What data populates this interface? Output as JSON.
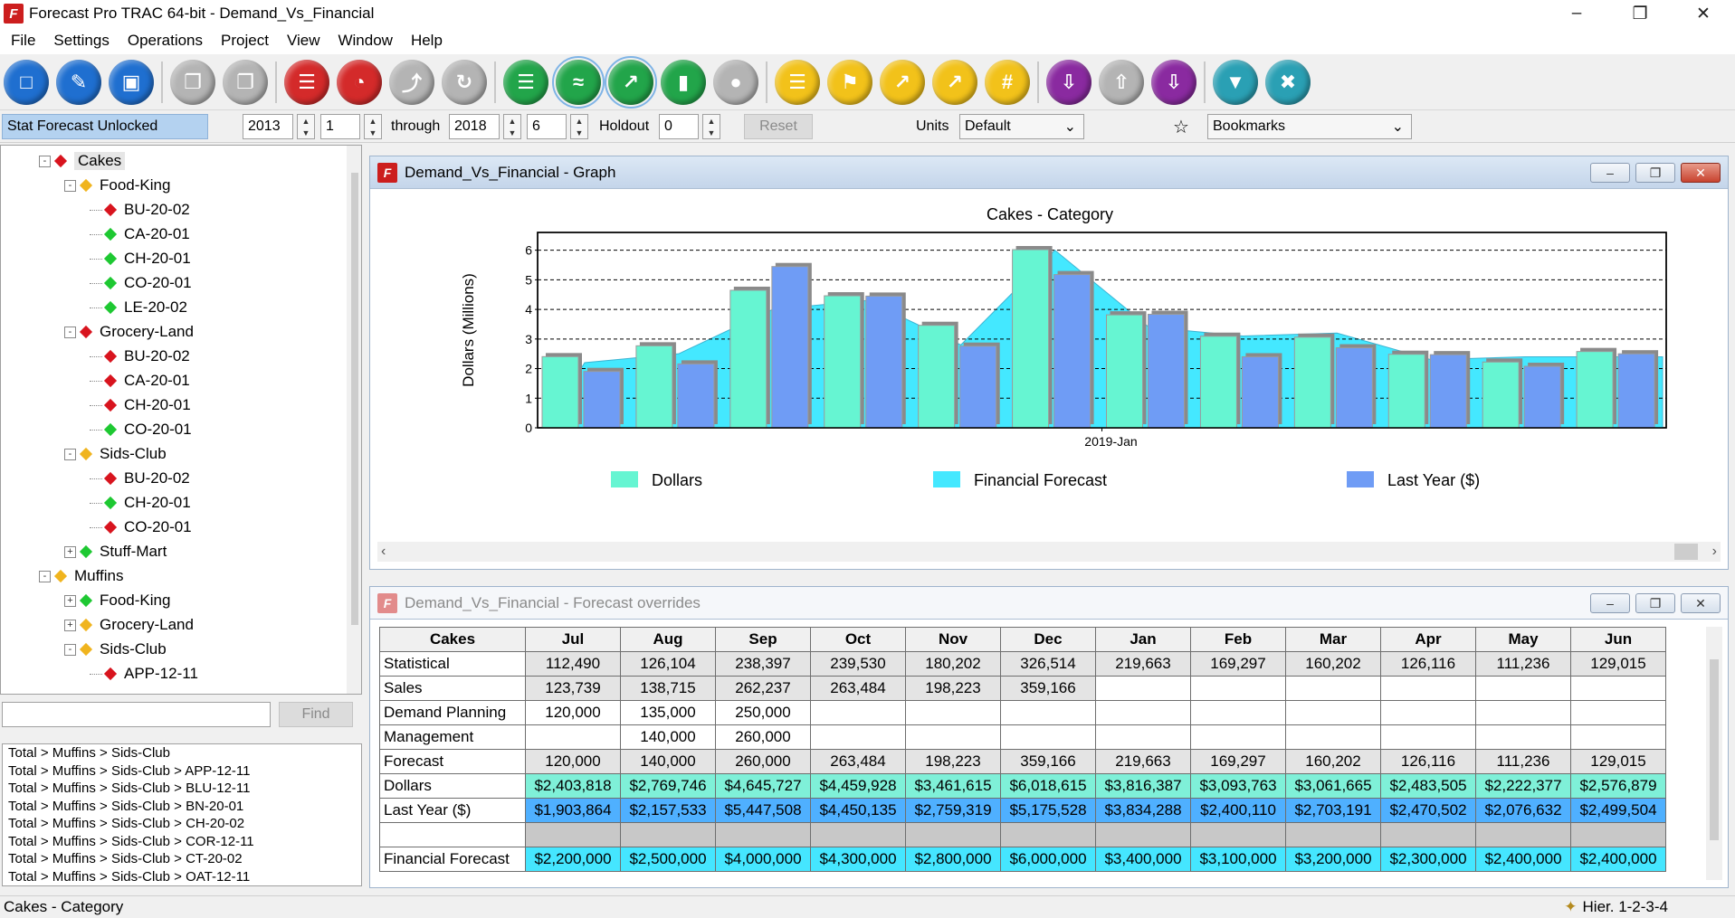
{
  "app": {
    "title": "Forecast Pro TRAC 64-bit - Demand_Vs_Financial",
    "icon": "forecast-pro-logo"
  },
  "menu": [
    "File",
    "Settings",
    "Operations",
    "Project",
    "View",
    "Window",
    "Help"
  ],
  "toolbar_icons": [
    {
      "name": "new-project-icon",
      "color": "#1f6fd0"
    },
    {
      "name": "open-project-icon",
      "color": "#1f6fd0"
    },
    {
      "name": "save-project-icon",
      "color": "#1f6fd0"
    },
    {
      "name": "copy-icon",
      "color": "#b4b4b4"
    },
    {
      "name": "paste-icon",
      "color": "#b4b4b4"
    },
    {
      "name": "database-icon",
      "color": "#d42a2a"
    },
    {
      "name": "pie-chart-icon",
      "color": "#d42a2a"
    },
    {
      "name": "model-icon",
      "color": "#b4b4b4"
    },
    {
      "name": "refresh-icon",
      "color": "#b4b4b4"
    },
    {
      "name": "report-icon",
      "color": "#22a54a"
    },
    {
      "name": "forecast-graph-icon",
      "color": "#22a54a"
    },
    {
      "name": "trend-graph-icon",
      "color": "#22a54a"
    },
    {
      "name": "bar-graph-icon",
      "color": "#22a54a"
    },
    {
      "name": "paw-icon",
      "color": "#b4b4b4"
    },
    {
      "name": "document-icon",
      "color": "#f2c21a"
    },
    {
      "name": "flag-icon",
      "color": "#f2c21a"
    },
    {
      "name": "line-chart-icon",
      "color": "#f2c21a"
    },
    {
      "name": "override-chart-icon",
      "color": "#f2c21a"
    },
    {
      "name": "hash-icon",
      "color": "#f2c21a"
    },
    {
      "name": "export-icon",
      "color": "#8a2aa0"
    },
    {
      "name": "import-icon",
      "color": "#b4b4b4"
    },
    {
      "name": "output-icon",
      "color": "#8a2aa0"
    },
    {
      "name": "filter-icon",
      "color": "#2aa0b4"
    },
    {
      "name": "tools-icon",
      "color": "#2aa0b4"
    }
  ],
  "controls": {
    "status_label": "Stat Forecast Unlocked",
    "start_year": "2013",
    "start_period": "1",
    "through_label": "through",
    "end_year": "2018",
    "end_period": "6",
    "holdout_label": "Holdout",
    "holdout_value": "0",
    "reset_label": "Reset",
    "units_label": "Units",
    "units_value": "Default",
    "bookmarks_value": "Bookmarks"
  },
  "tree": [
    {
      "label": "Cakes",
      "level": 0,
      "marker": "red",
      "expand": "-",
      "selected": true
    },
    {
      "label": "Food-King",
      "level": 1,
      "marker": "yellow",
      "expand": "-"
    },
    {
      "label": "BU-20-02",
      "level": 2,
      "marker": "red"
    },
    {
      "label": "CA-20-01",
      "level": 2,
      "marker": "green"
    },
    {
      "label": "CH-20-01",
      "level": 2,
      "marker": "green"
    },
    {
      "label": "CO-20-01",
      "level": 2,
      "marker": "green"
    },
    {
      "label": "LE-20-02",
      "level": 2,
      "marker": "green"
    },
    {
      "label": "Grocery-Land",
      "level": 1,
      "marker": "red",
      "expand": "-"
    },
    {
      "label": "BU-20-02",
      "level": 2,
      "marker": "red"
    },
    {
      "label": "CA-20-01",
      "level": 2,
      "marker": "red"
    },
    {
      "label": "CH-20-01",
      "level": 2,
      "marker": "red"
    },
    {
      "label": "CO-20-01",
      "level": 2,
      "marker": "green"
    },
    {
      "label": "Sids-Club",
      "level": 1,
      "marker": "yellow",
      "expand": "-"
    },
    {
      "label": "BU-20-02",
      "level": 2,
      "marker": "red"
    },
    {
      "label": "CH-20-01",
      "level": 2,
      "marker": "green"
    },
    {
      "label": "CO-20-01",
      "level": 2,
      "marker": "red"
    },
    {
      "label": "Stuff-Mart",
      "level": 1,
      "marker": "green",
      "expand": "+"
    },
    {
      "label": "Muffins",
      "level": 0,
      "marker": "yellow",
      "expand": "-"
    },
    {
      "label": "Food-King",
      "level": 1,
      "marker": "green",
      "expand": "+"
    },
    {
      "label": "Grocery-Land",
      "level": 1,
      "marker": "yellow",
      "expand": "+"
    },
    {
      "label": "Sids-Club",
      "level": 1,
      "marker": "yellow",
      "expand": "-"
    },
    {
      "label": "APP-12-11",
      "level": 2,
      "marker": "red"
    }
  ],
  "find": {
    "button_label": "Find",
    "value": ""
  },
  "paths": [
    "Total > Muffins > Sids-Club",
    "Total > Muffins > Sids-Club > APP-12-11",
    "Total > Muffins > Sids-Club > BLU-12-11",
    "Total > Muffins > Sids-Club > BN-20-01",
    "Total > Muffins > Sids-Club > CH-20-02",
    "Total > Muffins > Sids-Club > COR-12-11",
    "Total > Muffins > Sids-Club > CT-20-02",
    "Total > Muffins > Sids-Club > OAT-12-11"
  ],
  "graph_window": {
    "title": "Demand_Vs_Financial - Graph"
  },
  "overrides_window": {
    "title": "Demand_Vs_Financial - Forecast overrides"
  },
  "chart_data": {
    "type": "bar",
    "title": "Cakes - Category",
    "ylabel": "Dollars (Millions)",
    "xlabel": "",
    "x_tick_label": "2019-Jan",
    "ylim": [
      0,
      6.6
    ],
    "yticks": [
      0,
      1,
      2,
      3,
      4,
      5,
      6
    ],
    "grid": "horizontal-dashed",
    "legend_position": "bottom",
    "periods": [
      "Jul",
      "Aug",
      "Sep",
      "Oct",
      "Nov",
      "Dec",
      "Jan",
      "Feb",
      "Mar",
      "Apr",
      "May",
      "Jun"
    ],
    "series": [
      {
        "name": "Dollars",
        "kind": "bar",
        "color": "#66f5d2",
        "values": [
          2.404,
          2.77,
          4.646,
          4.46,
          3.462,
          6.019,
          3.816,
          3.094,
          3.062,
          2.484,
          2.222,
          2.577
        ]
      },
      {
        "name": "Financial Forecast",
        "kind": "area",
        "color": "#44e8ff",
        "values": [
          2.2,
          2.5,
          4.0,
          4.3,
          2.8,
          6.0,
          3.4,
          3.1,
          3.2,
          2.3,
          2.4,
          2.4
        ]
      },
      {
        "name": "Last Year ($)",
        "kind": "bar",
        "color": "#6f9cf5",
        "values": [
          1.904,
          2.158,
          5.448,
          4.45,
          2.759,
          5.176,
          3.834,
          2.4,
          2.703,
          2.471,
          2.077,
          2.5
        ]
      }
    ]
  },
  "table": {
    "corner": "Cakes",
    "columns": [
      "Jul",
      "Aug",
      "Sep",
      "Oct",
      "Nov",
      "Dec",
      "Jan",
      "Feb",
      "Mar",
      "Apr",
      "May",
      "Jun"
    ],
    "rows": [
      {
        "label": "Statistical",
        "style": "gray",
        "cells": [
          "112,490",
          "126,104",
          "238,397",
          "239,530",
          "180,202",
          "326,514",
          "219,663",
          "169,297",
          "160,202",
          "126,116",
          "111,236",
          "129,015"
        ]
      },
      {
        "label": "Sales",
        "style": "mixed",
        "cells": [
          "123,739",
          "138,715",
          "262,237",
          "263,484",
          "198,223",
          "359,166",
          "",
          "",
          "",
          "",
          "",
          ""
        ]
      },
      {
        "label": "Demand Planning",
        "style": "white",
        "cells": [
          "120,000",
          "135,000",
          "250,000",
          "",
          "",
          "",
          "",
          "",
          "",
          "",
          "",
          ""
        ]
      },
      {
        "label": "Management",
        "style": "white",
        "cells": [
          "",
          "140,000",
          "260,000",
          "",
          "",
          "",
          "",
          "",
          "",
          "",
          "",
          ""
        ]
      },
      {
        "label": "Forecast",
        "style": "gray",
        "cells": [
          "120,000",
          "140,000",
          "260,000",
          "263,484",
          "198,223",
          "359,166",
          "219,663",
          "169,297",
          "160,202",
          "126,116",
          "111,236",
          "129,015"
        ]
      },
      {
        "label": "Dollars",
        "style": "dollars",
        "cells": [
          "$2,403,818",
          "$2,769,746",
          "$4,645,727",
          "$4,459,928",
          "$3,461,615",
          "$6,018,615",
          "$3,816,387",
          "$3,093,763",
          "$3,061,665",
          "$2,483,505",
          "$2,222,377",
          "$2,576,879"
        ]
      },
      {
        "label": "Last Year ($)",
        "style": "lastyear",
        "cells": [
          "$1,903,864",
          "$2,157,533",
          "$5,447,508",
          "$4,450,135",
          "$2,759,319",
          "$5,175,528",
          "$3,834,288",
          "$2,400,110",
          "$2,703,191",
          "$2,470,502",
          "$2,076,632",
          "$2,499,504"
        ]
      },
      {
        "label": "",
        "style": "blankrow",
        "cells": [
          "",
          "",
          "",
          "",
          "",
          "",
          "",
          "",
          "",
          "",
          "",
          ""
        ]
      },
      {
        "label": "Financial Forecast",
        "style": "finfc",
        "cells": [
          "$2,200,000",
          "$2,500,000",
          "$4,000,000",
          "$4,300,000",
          "$2,800,000",
          "$6,000,000",
          "$3,400,000",
          "$3,100,000",
          "$3,200,000",
          "$2,300,000",
          "$2,400,000",
          "$2,400,000"
        ]
      }
    ]
  },
  "statusbar": {
    "left": "Cakes - Category",
    "right": "Hier. 1-2-3-4"
  }
}
